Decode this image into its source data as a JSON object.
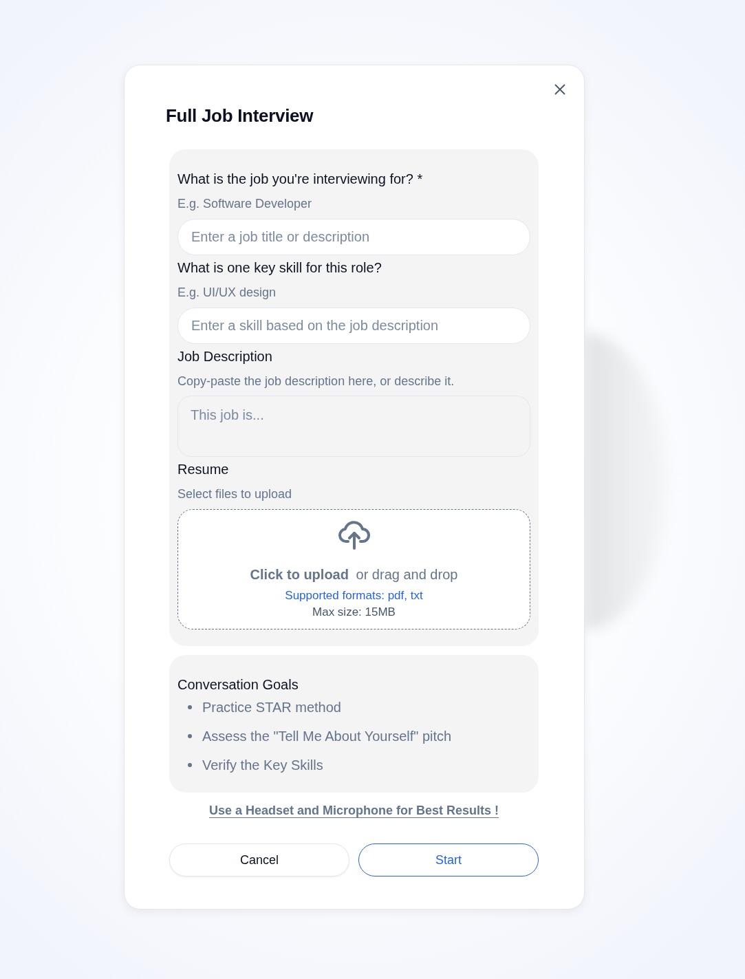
{
  "dialog": {
    "title": "Full Job Interview"
  },
  "form": {
    "fields": [
      {
        "kind": "input",
        "label": "What is the job you're interviewing for? *",
        "hint": "E.g. Software Developer",
        "placeholder": "Enter a job title or description"
      },
      {
        "kind": "input",
        "label": "What is one key skill for this role?",
        "hint": "E.g. UI/UX design",
        "placeholder": "Enter a skill based on the job description"
      },
      {
        "kind": "textarea",
        "label": "Job Description",
        "hint": "Copy-paste the job description here, or describe it.",
        "placeholder": "This job is..."
      },
      {
        "kind": "upload",
        "label": "Resume",
        "hint": "Select files to upload",
        "prompt": "**Click to upload** or drag and drop",
        "formats": "Supported formats: pdf, txt",
        "max_size": "Max size: 15MB"
      }
    ]
  },
  "goals": {
    "title": "Conversation Goals",
    "items": [
      "Practice STAR method",
      "Assess the \"Tell Me About Yourself\" pitch",
      "Verify the Key Skills"
    ]
  },
  "tip_link": "Use a Headset and Microphone for Best Results !",
  "buttons": [
    {
      "kind": "secondary",
      "label": "Cancel"
    },
    {
      "kind": "primary",
      "label": "Start"
    }
  ]
}
